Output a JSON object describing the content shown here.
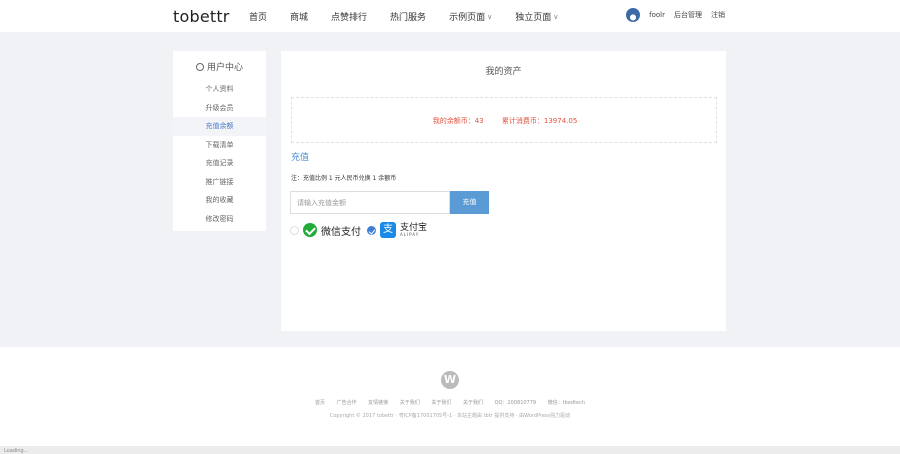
{
  "header": {
    "logo": "tobettr",
    "nav": [
      {
        "label": "首页",
        "chevron": false
      },
      {
        "label": "商城",
        "chevron": false
      },
      {
        "label": "点赞排行",
        "chevron": false
      },
      {
        "label": "热门服务",
        "chevron": false
      },
      {
        "label": "示例页面",
        "chevron": true
      },
      {
        "label": "独立页面",
        "chevron": true
      }
    ],
    "username": "foolr",
    "links": [
      "后台管理",
      "注销"
    ]
  },
  "sidebar": {
    "title": "用户中心",
    "items": [
      {
        "label": "个人资料",
        "active": false
      },
      {
        "label": "升级会员",
        "active": false
      },
      {
        "label": "充值余额",
        "active": true
      },
      {
        "label": "下载清单",
        "active": false
      },
      {
        "label": "充值记录",
        "active": false
      },
      {
        "label": "推广链接",
        "active": false
      },
      {
        "label": "我的收藏",
        "active": false
      },
      {
        "label": "修改密码",
        "active": false
      }
    ]
  },
  "main": {
    "title": "我的资产",
    "current_balance": "我的余额币：43",
    "total_consumed": "累计消费币：13974.05",
    "recharge_heading": "充值",
    "note": "注：充值比例 1 元人民币兑换 1 余额币",
    "amount_placeholder": "请输入充值金额",
    "recharge_button": "充值",
    "payment": {
      "wechat_label": "微信支付",
      "alipay_label": "支付宝",
      "alipay_en": "ALIPAY",
      "selected": "alipay"
    }
  },
  "footer": {
    "logo": "W",
    "links": [
      "首页",
      "广告合作",
      "友情链接",
      "关于我们",
      "关于我们",
      "关于我们",
      "QQ：200810779",
      "微信：tbedtech"
    ],
    "copyright": "Copyright © 2017 tobettr  ·  粤ICP备17001705号-1  ·  本站主题由 tbtr 提供支持  ·  由WordPress强力驱动"
  },
  "status_bar": "Loading..."
}
